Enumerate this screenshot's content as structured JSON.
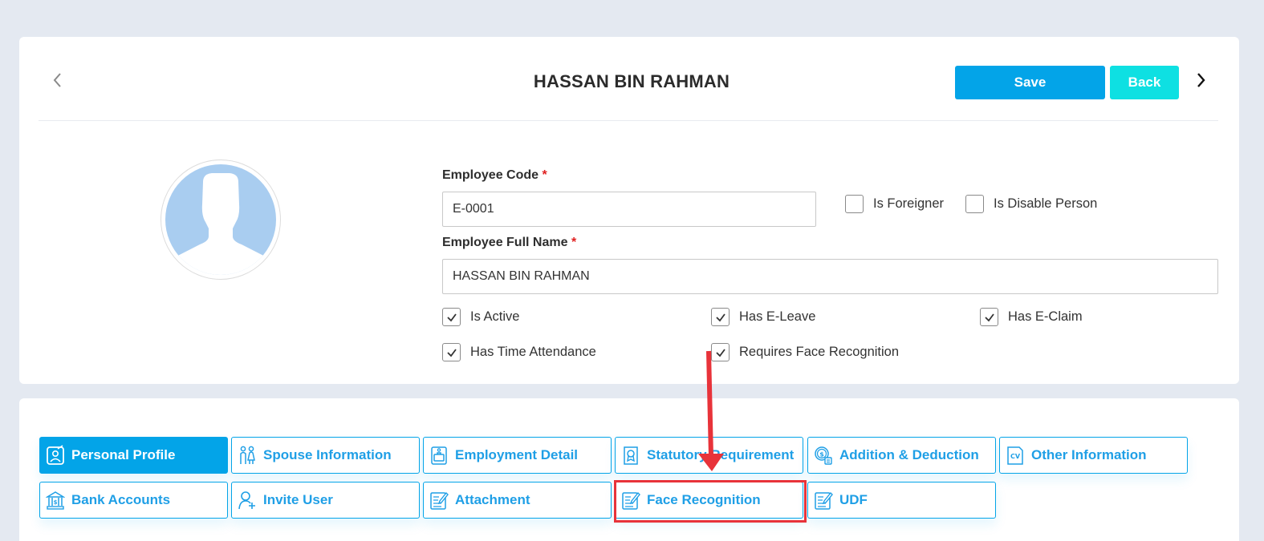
{
  "header": {
    "title": "HASSAN BIN RAHMAN",
    "save_label": "Save",
    "back_label": "Back"
  },
  "form": {
    "employee_code_label": "Employee Code",
    "employee_code_value": "E-0001",
    "full_name_label": "Employee Full Name",
    "full_name_value": "HASSAN BIN RAHMAN",
    "required_marker": "*"
  },
  "checkboxes": [
    {
      "label": "Is Foreigner",
      "checked": false
    },
    {
      "label": "Is Disable Person",
      "checked": false
    },
    {
      "label": "Is Active",
      "checked": true
    },
    {
      "label": "Has E-Leave",
      "checked": true
    },
    {
      "label": "Has E-Claim",
      "checked": true
    },
    {
      "label": "Has Time Attendance",
      "checked": true
    },
    {
      "label": "Requires Face Recognition",
      "checked": true
    }
  ],
  "tabs": [
    {
      "label": "Personal Profile",
      "icon": "personal-profile-icon",
      "active": true
    },
    {
      "label": "Spouse Information",
      "icon": "spouse-icon",
      "active": false
    },
    {
      "label": "Employment Detail",
      "icon": "employment-icon",
      "active": false
    },
    {
      "label": "Statutory Requirement",
      "icon": "statutory-icon",
      "active": false
    },
    {
      "label": "Addition & Deduction",
      "icon": "money-icon",
      "active": false
    },
    {
      "label": "Other Information",
      "icon": "cv-icon",
      "active": false
    },
    {
      "label": "Bank Accounts",
      "icon": "bank-icon",
      "active": false
    },
    {
      "label": "Invite User",
      "icon": "add-user-icon",
      "active": false
    },
    {
      "label": "Attachment",
      "icon": "document-edit-icon",
      "active": false
    },
    {
      "label": "Face Recognition",
      "icon": "document-edit-icon",
      "active": false
    },
    {
      "label": "UDF",
      "icon": "document-edit-icon",
      "active": false
    }
  ],
  "colors": {
    "primary": "#03a4e8",
    "back_button": "#0ee0e2",
    "annotation": "#e8333a",
    "avatar": "#a9cdf0"
  }
}
